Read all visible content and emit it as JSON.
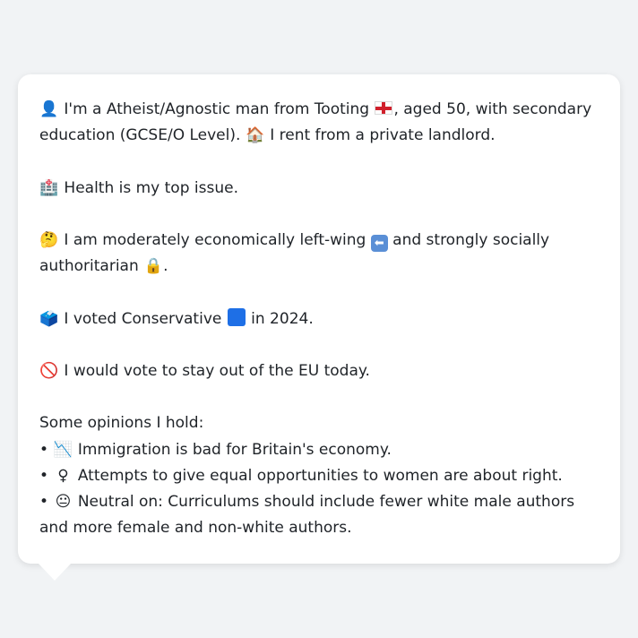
{
  "profile": {
    "line1_a": "I'm a Atheist/Agnostic man from Tooting",
    "line1_b": ", aged 50, with secondary education (GCSE/O Level).",
    "line1_c": "I rent from a private landlord.",
    "health": "Health is my top issue.",
    "economy_a": "I am moderately economically left-wing",
    "economy_b": "and strongly socially authoritarian",
    "vote_a": "I voted Conservative",
    "vote_b": "in 2024.",
    "eu": "I would vote to stay out of the EU today.",
    "opinions_heading": "Some opinions I hold:",
    "opinions": [
      "Immigration is bad for Britain's economy.",
      "Attempts to give equal opportunities to women are about right.",
      "Neutral on: Curriculums should include fewer white male authors and more female and non-white authors."
    ]
  },
  "icons": {
    "person": "👤",
    "house": "🏠",
    "hospital": "🏥",
    "thinking": "🤔",
    "lock": "🔒",
    "ballot": "🗳️",
    "no_entry": "🚫",
    "chart_down": "📉",
    "female": "♀",
    "neutral_face": "😐",
    "bullet": "•"
  },
  "colors": {
    "background": "#f1f3f5",
    "bubble": "#ffffff",
    "text": "#1f2328",
    "conservative_blue": "#1e6fe6",
    "flag_red": "#d0202c"
  }
}
